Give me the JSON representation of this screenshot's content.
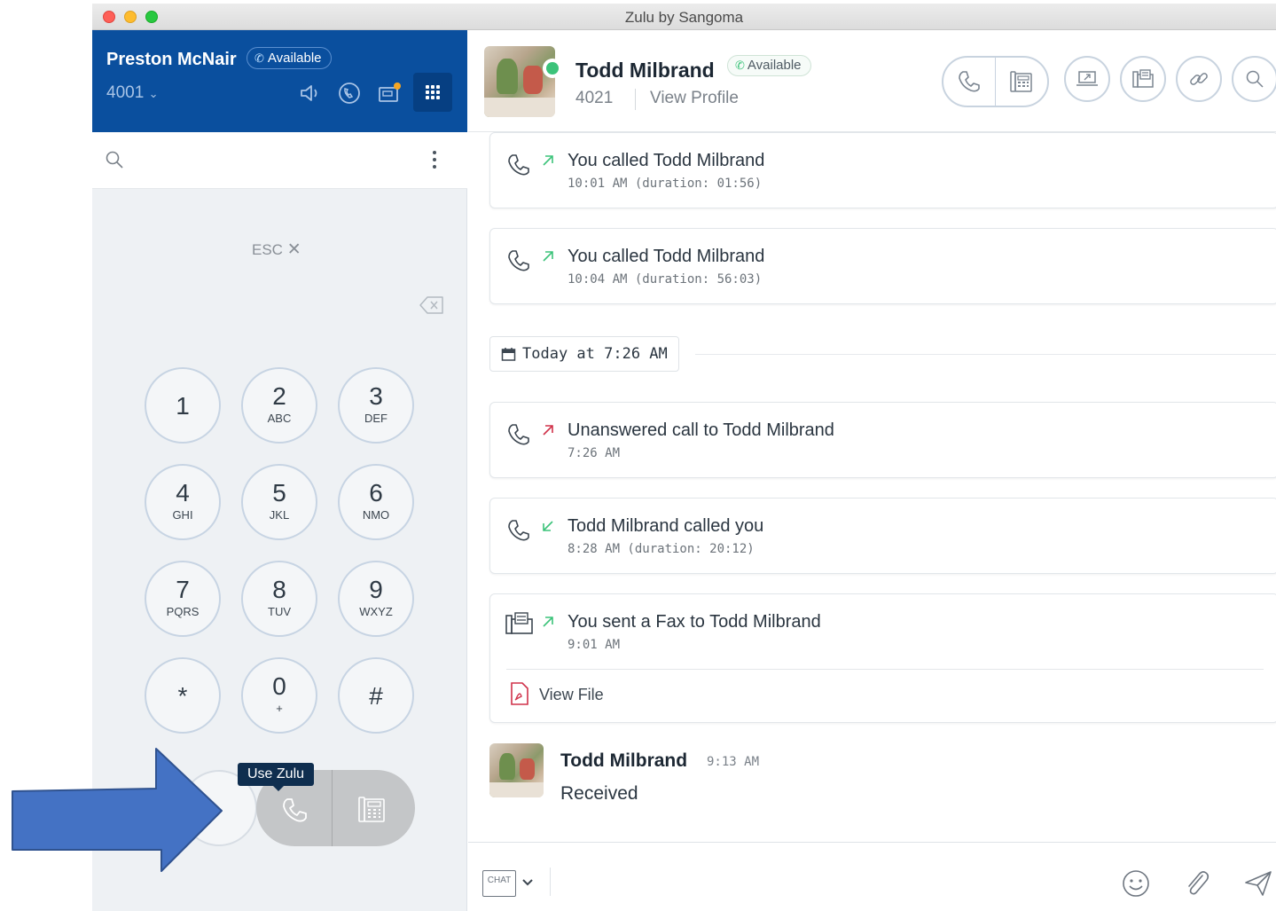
{
  "window": {
    "title": "Zulu by Sangoma"
  },
  "user": {
    "name": "Preston McNair",
    "status": "Available",
    "extension": "4001"
  },
  "dialer": {
    "esc_label": "ESC",
    "keys": [
      {
        "digit": "1",
        "letters": ""
      },
      {
        "digit": "2",
        "letters": "ABC"
      },
      {
        "digit": "3",
        "letters": "DEF"
      },
      {
        "digit": "4",
        "letters": "GHI"
      },
      {
        "digit": "5",
        "letters": "JKL"
      },
      {
        "digit": "6",
        "letters": "NMO"
      },
      {
        "digit": "7",
        "letters": "PQRS"
      },
      {
        "digit": "8",
        "letters": "TUV"
      },
      {
        "digit": "9",
        "letters": "WXYZ"
      },
      {
        "digit": "*",
        "letters": ""
      },
      {
        "digit": "0",
        "letters": "+"
      },
      {
        "digit": "#",
        "letters": ""
      }
    ],
    "tooltip": "Use Zulu"
  },
  "contact": {
    "name": "Todd Milbrand",
    "status": "Available",
    "extension": "4021",
    "view_profile": "View Profile"
  },
  "feed": {
    "items": [
      {
        "title": "You called Todd Milbrand",
        "subtitle": "10:01 AM (duration: 01:56)",
        "direction": "outgoing",
        "type": "call"
      },
      {
        "title": "You called Todd Milbrand",
        "subtitle": "10:04 AM (duration: 56:03)",
        "direction": "outgoing",
        "type": "call"
      },
      {
        "title": "Unanswered call to Todd Milbrand",
        "subtitle": "7:26 AM",
        "direction": "missed",
        "type": "call"
      },
      {
        "title": "Todd Milbrand called you",
        "subtitle": "8:28 AM (duration: 20:12)",
        "direction": "incoming",
        "type": "call"
      },
      {
        "title": "You sent a Fax to Todd Milbrand",
        "subtitle": "9:01 AM",
        "direction": "outgoing",
        "type": "fax"
      }
    ],
    "date_separator": "Today at 7:26 AM",
    "view_file": "View File",
    "message": {
      "sender": "Todd Milbrand",
      "time": "9:13 AM",
      "text": "Received"
    }
  },
  "composer": {
    "channel": "CHAT"
  },
  "colors": {
    "brand_blue": "#0a4f9e",
    "available_green": "#3cc37a",
    "missed_red": "#d0324a",
    "outgoing_green": "#3cc37a",
    "annotation_arrow": "#4472c4"
  }
}
